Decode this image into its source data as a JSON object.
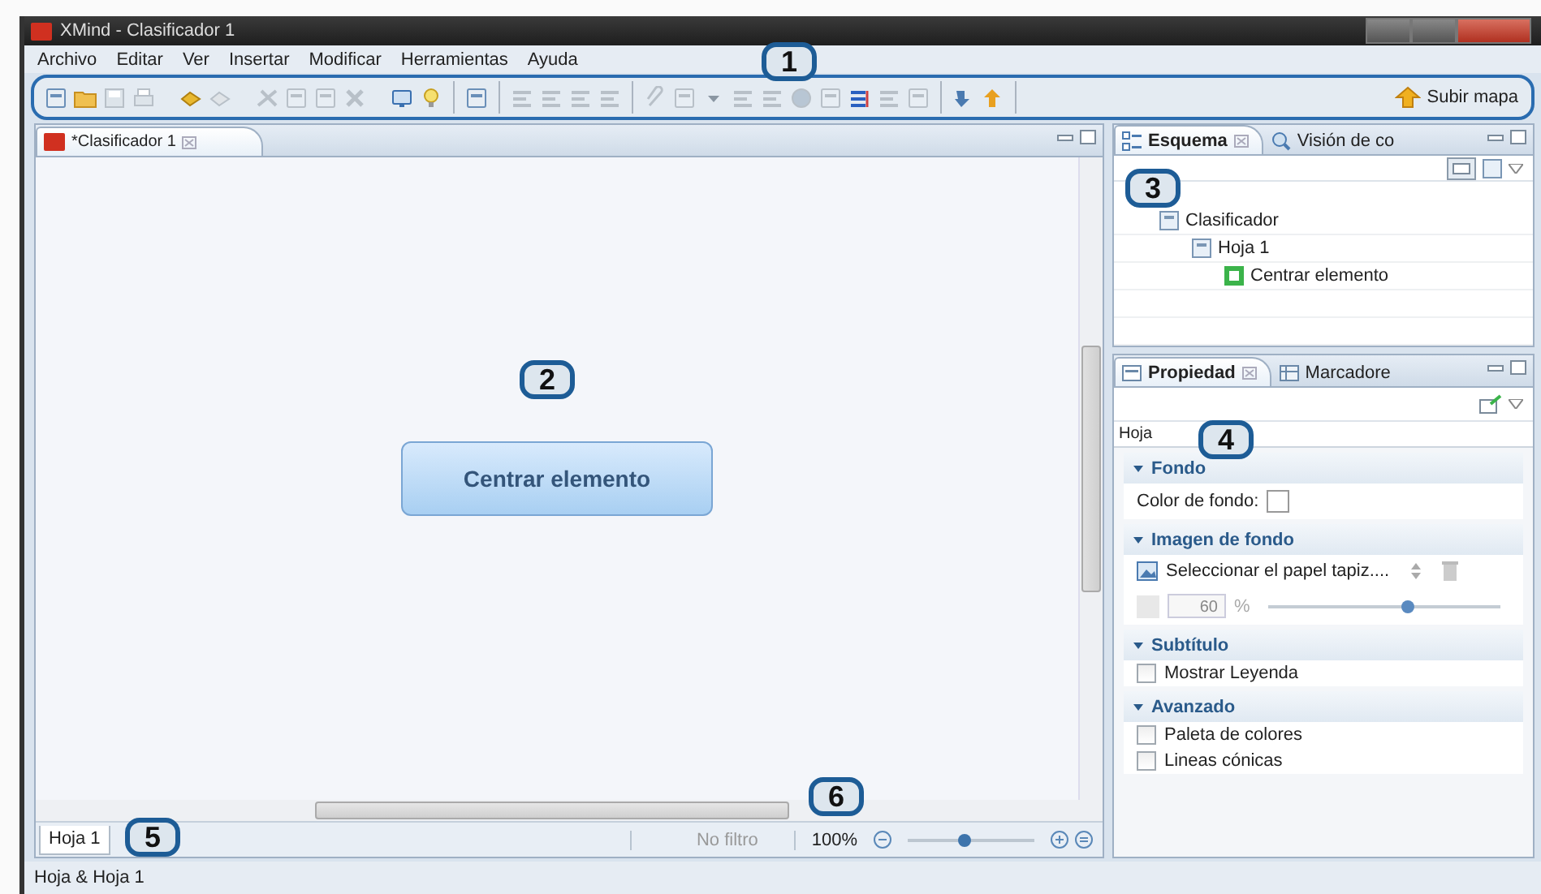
{
  "window": {
    "title": "XMind - Clasificador 1"
  },
  "menu": [
    "Archivo",
    "Editar",
    "Ver",
    "Insertar",
    "Modificar",
    "Herramientas",
    "Ayuda"
  ],
  "toolbar": {
    "button": "Subir mapa"
  },
  "editor": {
    "tab": "*Clasificador 1",
    "topic": "Centrar elemento",
    "sheet_tab": "Hoja 1",
    "filter": "No filtro",
    "zoom": "100%",
    "zoom_slider": {
      "level": 0.45
    }
  },
  "outline": {
    "tabs": [
      {
        "label": "Esquema",
        "selected": true
      },
      {
        "label": "Visión de co",
        "selected": false
      }
    ],
    "tree": [
      {
        "label": "Clasificador",
        "children": [
          {
            "label": "Hoja 1",
            "children": [
              {
                "label": "Centrar elemento"
              }
            ]
          }
        ]
      }
    ]
  },
  "properties": {
    "tabs": [
      {
        "label": "Propiedad",
        "selected": true
      },
      {
        "label": "Marcadore",
        "selected": false
      }
    ],
    "heading": "Hoja",
    "sections": [
      {
        "title": "Fondo",
        "expanded": true,
        "items": [
          {
            "kind": "color",
            "label": "Color de fondo:"
          }
        ]
      },
      {
        "title": "Imagen de fondo",
        "expanded": true,
        "items": [
          {
            "kind": "select",
            "label": "Seleccionar el papel tapiz...."
          },
          {
            "kind": "opacity",
            "value": "60",
            "unit": "%",
            "level": 0.6
          }
        ]
      },
      {
        "title": "Subtítulo",
        "expanded": true,
        "items": [
          {
            "kind": "checkbox",
            "label": "Mostrar Leyenda",
            "checked": false
          }
        ]
      },
      {
        "title": "Avanzado",
        "expanded": true,
        "items": [
          {
            "kind": "checkbox",
            "label": "Paleta de colores",
            "checked": false
          },
          {
            "kind": "checkbox",
            "label": "Lineas cónicas",
            "checked": false
          }
        ]
      }
    ]
  },
  "status_bar": "Hoja & Hoja 1",
  "callouts": [
    "1",
    "2",
    "3",
    "4",
    "5",
    "6"
  ]
}
